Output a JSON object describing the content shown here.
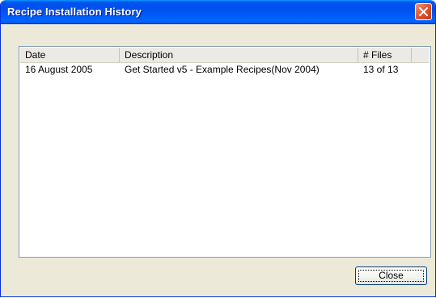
{
  "window": {
    "title": "Recipe Installation History"
  },
  "list": {
    "columns": [
      "Date",
      "Description",
      "# Files"
    ],
    "rows": [
      {
        "date": "16 August 2005",
        "description": "Get Started v5 - Example Recipes(Nov 2004)",
        "files": "13 of 13"
      }
    ]
  },
  "buttons": {
    "close_label": "Close"
  },
  "colors": {
    "titlebar": "#0053EE",
    "dialog_bg": "#ECE9D8",
    "close_button": "#E2582F",
    "list_border": "#7F9DB9"
  }
}
